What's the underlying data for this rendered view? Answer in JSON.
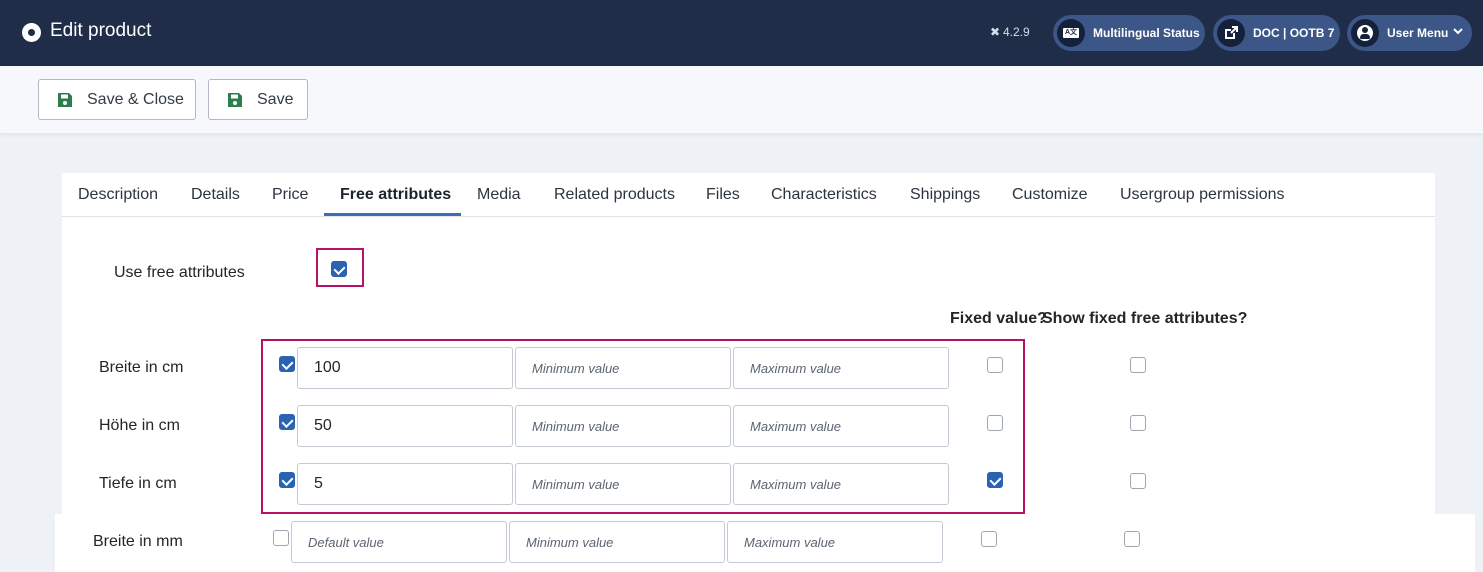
{
  "header": {
    "title": "Edit product",
    "version": "4.2.9",
    "multilingual": "Multilingual Status",
    "doc": "DOC | OOTB 7",
    "user_menu": "User Menu",
    "ml_glyph": "A文"
  },
  "toolbar": {
    "save_close": "Save & Close",
    "save": "Save"
  },
  "tabs": [
    "Description",
    "Details",
    "Price",
    "Free attributes",
    "Media",
    "Related products",
    "Files",
    "Characteristics",
    "Shippings",
    "Customize",
    "Usergroup permissions"
  ],
  "active_tab": "Free attributes",
  "use_free_attributes": {
    "label": "Use free attributes",
    "checked": true
  },
  "columns": {
    "fixed_value": "Fixed value?",
    "show_fixed": "Show fixed free attributes?"
  },
  "attributes": [
    {
      "label": "Breite in cm",
      "enabled": true,
      "value": "100",
      "min_placeholder": "Minimum value",
      "max_placeholder": "Maximum value",
      "fixed": false,
      "show_fixed": false
    },
    {
      "label": "Höhe in cm",
      "enabled": true,
      "value": "50",
      "min_placeholder": "Minimum value",
      "max_placeholder": "Maximum value",
      "fixed": false,
      "show_fixed": false
    },
    {
      "label": "Tiefe in cm",
      "enabled": true,
      "value": "5",
      "min_placeholder": "Minimum value",
      "max_placeholder": "Maximum value",
      "fixed": true,
      "show_fixed": false
    },
    {
      "label": "Breite in mm",
      "enabled": false,
      "value_placeholder": "Default value",
      "min_placeholder": "Minimum value",
      "max_placeholder": "Maximum value",
      "fixed": false,
      "show_fixed": false
    }
  ],
  "colors": {
    "header_bg": "#1f2d48",
    "pill_bg": "#3b5687",
    "accent": "#2b62b1",
    "highlight": "#b71166",
    "save_icon": "#2e7d4f"
  }
}
